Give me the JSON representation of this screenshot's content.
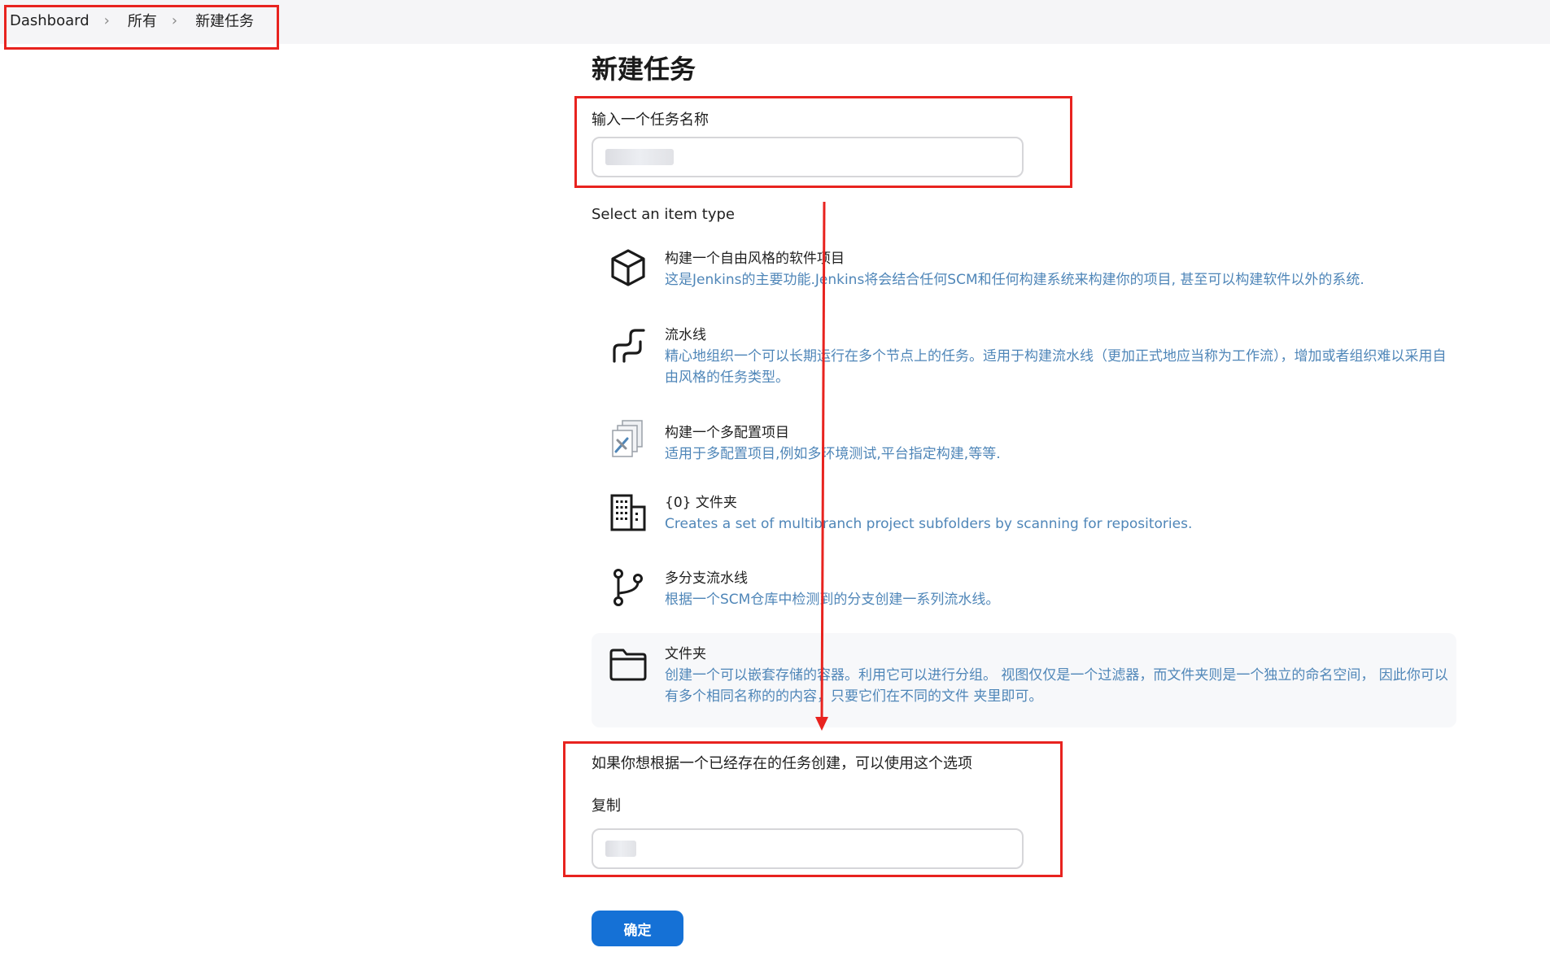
{
  "breadcrumb": {
    "items": [
      "Dashboard",
      "所有",
      "新建任务"
    ]
  },
  "page": {
    "title": "新建任务"
  },
  "name_field": {
    "label": "输入一个任务名称",
    "value": ""
  },
  "item_type": {
    "heading": "Select an item type",
    "items": [
      {
        "name": "构建一个自由风格的软件项目",
        "desc": "这是Jenkins的主要功能.Jenkins将会结合任何SCM和任何构建系统来构建你的项目, 甚至可以构建软件以外的系统.",
        "icon": "package-icon"
      },
      {
        "name": "流水线",
        "desc": "精心地组织一个可以长期运行在多个节点上的任务。适用于构建流水线（更加正式地应当称为工作流），增加或者组织难以采用自由风格的任务类型。",
        "icon": "pipeline-icon"
      },
      {
        "name": "构建一个多配置项目",
        "desc": "适用于多配置项目,例如多环境测试,平台指定构建,等等.",
        "icon": "multi-config-icon"
      },
      {
        "name": "{0} 文件夹",
        "desc": "Creates a set of multibranch project subfolders by scanning for repositories.",
        "icon": "organization-folder-icon"
      },
      {
        "name": "多分支流水线",
        "desc": "根据一个SCM仓库中检测到的分支创建一系列流水线。",
        "icon": "branch-icon"
      },
      {
        "name": "文件夹",
        "desc": "创建一个可以嵌套存储的容器。利用它可以进行分组。 视图仅仅是一个过滤器，而文件夹则是一个独立的命名空间， 因此你可以有多个相同名称的的内容，只要它们在不同的文件 夹里即可。",
        "icon": "folder-icon"
      }
    ]
  },
  "copy": {
    "hint": "如果你想根据一个已经存在的任务创建，可以使用这个选项",
    "label": "复制",
    "value": ""
  },
  "actions": {
    "ok_label": "确定"
  },
  "colors": {
    "accent": "#1571d6",
    "annotation": "#e8231f",
    "desc_text": "#4f86b8"
  }
}
